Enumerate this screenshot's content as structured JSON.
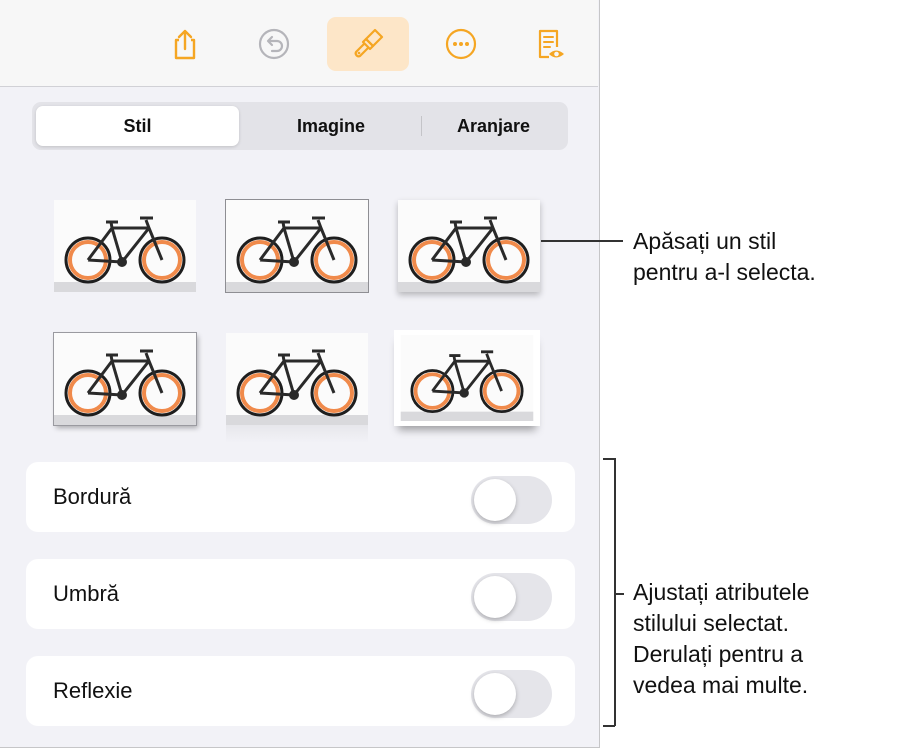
{
  "toolbar": {
    "buttons": [
      "share-icon",
      "undo-icon",
      "paintbrush-icon",
      "more-icon",
      "reading-view-icon"
    ],
    "active": "paintbrush-icon",
    "accent": "#f5a623"
  },
  "tabs": [
    {
      "label": "Stil",
      "selected": true
    },
    {
      "label": "Imagine",
      "selected": false
    },
    {
      "label": "Aranjare",
      "selected": false
    }
  ],
  "styles": {
    "thumbnails": [
      "plain",
      "thin-border",
      "soft-shadow",
      "frame-shadow",
      "reflection",
      "curled-shadow"
    ]
  },
  "options": [
    {
      "label": "Bordură",
      "enabled": false
    },
    {
      "label": "Umbră",
      "enabled": false
    },
    {
      "label": "Reflexie",
      "enabled": false
    }
  ],
  "callouts": {
    "styles": [
      "Apăsați un stil",
      "pentru a-l selecta."
    ],
    "attributes": [
      "Ajustați atributele",
      "stilului selectat.",
      "Derulați pentru a",
      "vedea mai multe."
    ]
  }
}
